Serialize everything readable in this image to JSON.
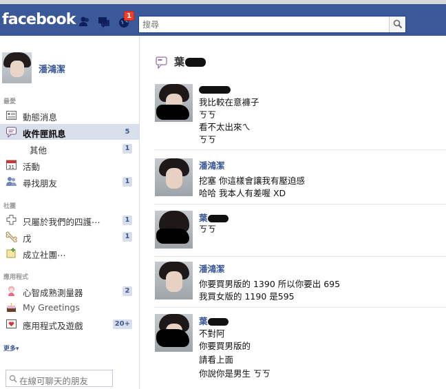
{
  "topbar": {
    "logo": "facebook",
    "notification_count": "1",
    "search_placeholder": "搜尋"
  },
  "profile": {
    "name": "潘鴻潔"
  },
  "sidebar": {
    "favorites_header": "最愛",
    "items": [
      {
        "label": "動態消息",
        "icon": "news-feed-icon",
        "count": ""
      },
      {
        "label": "收件匣訊息",
        "icon": "messages-icon",
        "count": "5",
        "selected": true
      },
      {
        "label": "其他",
        "icon": "",
        "count": "1",
        "sub": true
      },
      {
        "label": "活動",
        "icon": "calendar-icon",
        "count": ""
      },
      {
        "label": "尋找朋友",
        "icon": "friends-icon",
        "count": "1"
      }
    ],
    "groups_header": "社團",
    "groups": [
      {
        "label": "只屬於我們的四護⋯",
        "icon": "group-puzzle-icon",
        "count": "1"
      },
      {
        "label": "戊",
        "icon": "group-bone-icon",
        "count": "1"
      },
      {
        "label": "成立社團⋯",
        "icon": "create-group-icon",
        "count": ""
      }
    ],
    "apps_header": "應用程式",
    "apps": [
      {
        "label": "心智成熟測量器",
        "icon": "app-character-icon",
        "count": "2"
      },
      {
        "label": "My Greetings",
        "icon": "greetings-cake-icon",
        "count": ""
      },
      {
        "label": "應用程式及遊戲",
        "icon": "apps-games-icon",
        "count": "20+"
      }
    ],
    "more_label": "更多▾",
    "chat_placeholder": "在線可聊天的朋友"
  },
  "thread": {
    "title": "葉",
    "messages": [
      {
        "sender": "",
        "lines": [
          "我比較在意褲子",
          "ㄎㄎ",
          "看不太出來ㄟ",
          "ㄎㄎ"
        ]
      },
      {
        "sender": "潘鴻潔",
        "lines": [
          "挖塞 你這樣會讓我有壓迫感",
          "哈哈 我本人有差喔 XD"
        ]
      },
      {
        "sender": "葉",
        "lines": [
          "ㄎㄎ"
        ]
      },
      {
        "sender": "潘鴻潔",
        "lines": [
          "你要買男版的 1390 所以你要出 695",
          "我買女版的 1190 是595"
        ]
      },
      {
        "sender": "葉",
        "lines": [
          "不對阿",
          "你要買男版的",
          "請看上面",
          "你說你是男生 ㄎㄎ"
        ]
      }
    ]
  },
  "colors": {
    "brand": "#3b5998",
    "selected": "#d8dfea",
    "badge": "#f03d25"
  }
}
